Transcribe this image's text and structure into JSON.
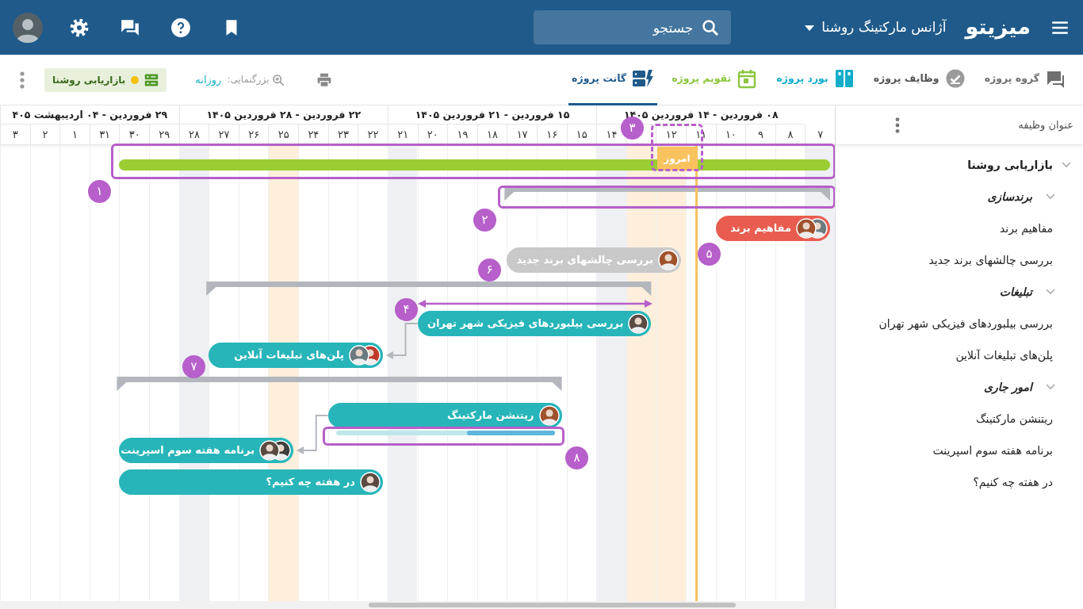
{
  "topbar": {
    "logo": "میزیتو",
    "workspace": "آژانس مارکتینگ روشنا",
    "search": {
      "placeholder": "جستجو"
    }
  },
  "tabs": [
    {
      "label": "گروه پروژه",
      "kind": "chat",
      "color": "#6f6f6f",
      "selected": false
    },
    {
      "label": "وظایف پروژه",
      "kind": "tasks",
      "color": "#555555",
      "selected": false
    },
    {
      "label": "بورد پروژه",
      "kind": "board",
      "color": "#14aecb",
      "selected": false
    },
    {
      "label": "تقویم پروژه",
      "kind": "calendar",
      "color": "#8cc63f",
      "selected": false
    },
    {
      "label": "گانت پروژه",
      "kind": "gantt",
      "color": "#1f5a8a",
      "selected": true
    }
  ],
  "toolbar": {
    "zoom_label": "بزرگنمایی:",
    "zoom_value": "روزانه",
    "project_chip": "بازاریابی روشنا"
  },
  "task_panel": {
    "header": "عنوان وظیفه",
    "items": [
      {
        "label": "بازاریابی روشنا",
        "kind": "project",
        "expanded": true,
        "children": [
          {
            "label": "برندسازی",
            "kind": "group",
            "expanded": true,
            "children": [
              {
                "label": "مفاهیم برند"
              },
              {
                "label": "بررسی چالشهای برند جدید"
              }
            ]
          },
          {
            "label": "تبلیغات",
            "kind": "group",
            "expanded": true,
            "children": [
              {
                "label": "بررسی بیلبوردهای فیزیکی شهر تهران"
              },
              {
                "label": "پلن‌های تبلیغات آنلاین"
              }
            ]
          },
          {
            "label": "امور جاری",
            "kind": "group",
            "expanded": true,
            "children": [
              {
                "label": "ریتنشن مارکتینگ"
              },
              {
                "label": "برنامه هفته سوم اسپرینت"
              },
              {
                "label": "در هفته چه کنیم؟"
              }
            ]
          }
        ]
      }
    ]
  },
  "timeline": {
    "weeks": [
      "۰۸ فروردین - ۱۴ فروردین ۱۴۰۵",
      "۱۵ فروردین - ۲۱ فروردین ۱۴۰۵",
      "۲۲ فروردین - ۲۸ فروردین ۱۴۰۵",
      "۲۹ فروردین - ۰۴ اردیبهشت ۴۰۵"
    ],
    "days": [
      {
        "label": "۷",
        "weekend": true,
        "holiday": false
      },
      {
        "label": "۸",
        "weekend": false,
        "holiday": false
      },
      {
        "label": "۹",
        "weekend": false,
        "holiday": false
      },
      {
        "label": "۱۰",
        "weekend": false,
        "holiday": false
      },
      {
        "label": "۱۱",
        "weekend": false,
        "holiday": false
      },
      {
        "label": "۱۲",
        "weekend": false,
        "holiday": true
      },
      {
        "weekend": false,
        "holiday": true
      },
      {
        "label": "۱۴",
        "weekend": true,
        "holiday": false
      },
      {
        "label": "۱۵",
        "weekend": false,
        "holiday": false
      },
      {
        "label": "۱۶",
        "weekend": false,
        "holiday": false
      },
      {
        "label": "۱۷",
        "weekend": false,
        "holiday": false
      },
      {
        "label": "۱۸",
        "weekend": false,
        "holiday": false
      },
      {
        "label": "۱۹",
        "weekend": false,
        "holiday": false
      },
      {
        "label": "۲۰",
        "weekend": false,
        "holiday": false
      },
      {
        "label": "۲۱",
        "weekend": true,
        "holiday": false
      },
      {
        "label": "۲۲",
        "weekend": false,
        "holiday": false
      },
      {
        "label": "۲۳",
        "weekend": false,
        "holiday": false
      },
      {
        "label": "۲۴",
        "weekend": false,
        "holiday": false
      },
      {
        "label": "۲۵",
        "weekend": false,
        "holiday": true
      },
      {
        "label": "۲۶",
        "weekend": false,
        "holiday": false
      },
      {
        "label": "۲۷",
        "weekend": false,
        "holiday": false
      },
      {
        "label": "۲۸",
        "weekend": true,
        "holiday": false
      },
      {
        "label": "۲۹",
        "weekend": false,
        "holiday": false
      },
      {
        "label": "۳۰",
        "weekend": false,
        "holiday": false
      },
      {
        "label": "۳۱",
        "weekend": false,
        "holiday": false
      },
      {
        "label": "۱",
        "weekend": false,
        "holiday": false
      },
      {
        "label": "۲",
        "weekend": false,
        "holiday": false
      },
      {
        "label": "۳",
        "weekend": false,
        "holiday": false
      }
    ],
    "today": "امروز"
  },
  "bars": [
    {
      "kind": "project",
      "color": "#9acd32"
    },
    {
      "kind": "summary"
    },
    {
      "kind": "task",
      "label": "مفاهیم برند",
      "color": "#e85d50"
    },
    {
      "kind": "task",
      "label": "بررسی چالشهای برند جدید",
      "color": "#c9c9c9"
    },
    {
      "kind": "summary"
    },
    {
      "kind": "task",
      "label": "بررسی بیلبوردهای فیزیکی شهر تهران",
      "color": "#27b5b9"
    },
    {
      "kind": "task",
      "label": "پلن‌های تبلیغات آنلاین",
      "color": "#27b5b9"
    },
    {
      "kind": "summary"
    },
    {
      "kind": "task",
      "label": "ریتنشن مارکتینگ",
      "color": "#27b5b9",
      "level": 0.4
    },
    {
      "kind": "task",
      "label": "برنامه هفته سوم اسپرینت",
      "color": "#27b5b9"
    },
    {
      "kind": "task",
      "label": "در هفته چه کنیم؟",
      "color": "#27b5b9"
    }
  ],
  "annotations": [
    {
      "label": "۱"
    },
    {
      "label": "۲"
    },
    {
      "label": "۳"
    },
    {
      "label": "۴"
    },
    {
      "label": "۵"
    },
    {
      "label": "۶"
    },
    {
      "label": "۷"
    },
    {
      "label": "۸"
    }
  ]
}
